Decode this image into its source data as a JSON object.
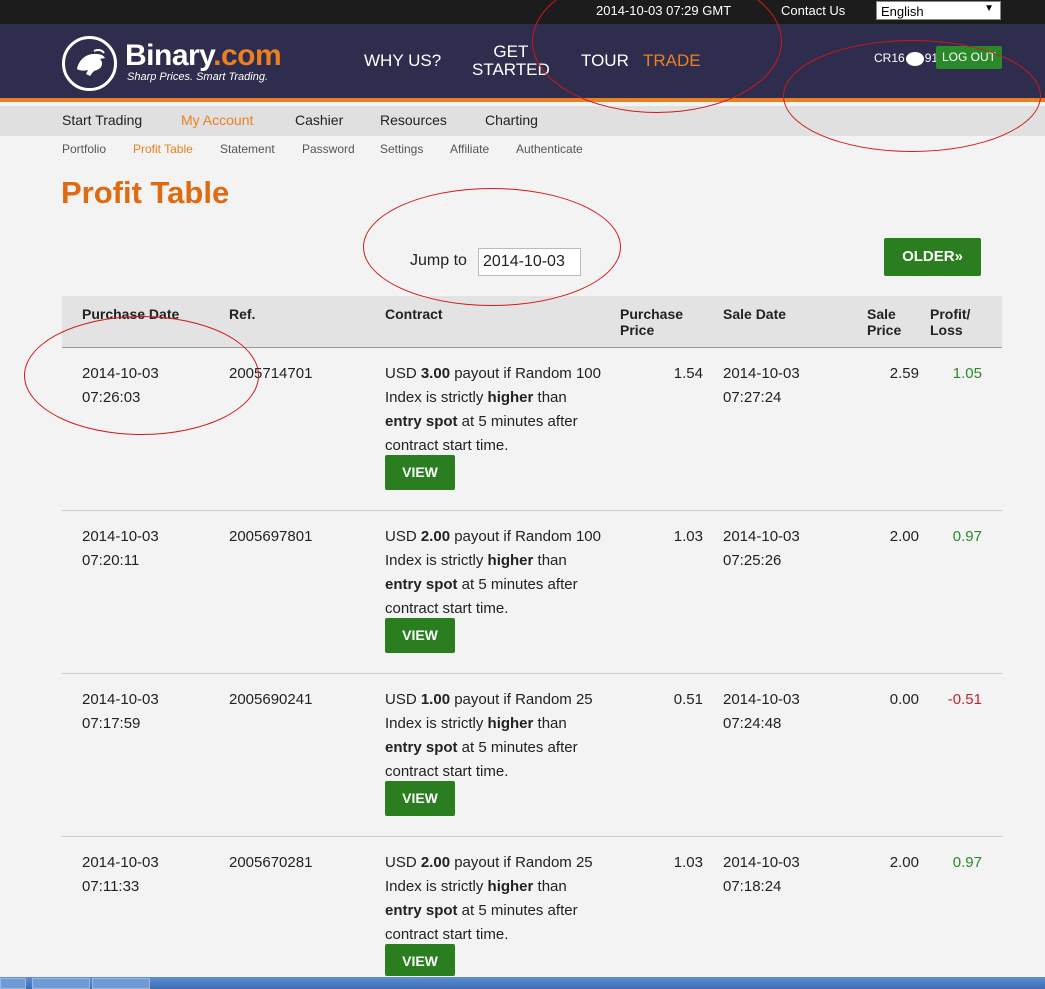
{
  "topbar": {
    "datetime": "2014-10-03 07:29 GMT",
    "contact": "Contact Us",
    "language": "English"
  },
  "header": {
    "brand_main": "Binary",
    "brand_suffix": ".com",
    "tagline": "Sharp Prices. Smart Trading.",
    "nav": {
      "why_us": "WHY US?",
      "get_started_1": "GET",
      "get_started_2": "STARTED",
      "tour": "TOUR",
      "trade": "TRADE"
    },
    "account_id": "CR16",
    "account_id_end": "91",
    "logout": "LOG OUT"
  },
  "menu": {
    "main": [
      "Start Trading",
      "My Account",
      "Cashier",
      "Resources",
      "Charting"
    ],
    "sub": [
      "Portfolio",
      "Profit Table",
      "Statement",
      "Password",
      "Settings",
      "Affiliate",
      "Authenticate"
    ]
  },
  "page": {
    "title": "Profit Table",
    "jump_label": "Jump to",
    "jump_value": "2014-10-03",
    "older": "OLDER»"
  },
  "table": {
    "headers": {
      "purchase_date": "Purchase Date",
      "ref": "Ref.",
      "contract": "Contract",
      "purchase_price_1": "Purchase",
      "purchase_price_2": "Price",
      "sale_date": "Sale Date",
      "sale_price_1": "Sale",
      "sale_price_2": "Price",
      "profit_1": "Profit/",
      "profit_2": "Loss"
    },
    "view_label": "VIEW",
    "rows": [
      {
        "pdate": "2014-10-03",
        "ptime": "07:26:03",
        "ref": "2005714701",
        "c1": "USD ",
        "c_amount": "3.00",
        "c2": " payout if Random 100 Index is strictly ",
        "c_dir": "higher",
        "c3": " than ",
        "c_spot": "entry spot",
        "c4": " at 5 minutes after contract start time.",
        "purchase": "1.54",
        "sdate": "2014-10-03",
        "stime": "07:27:24",
        "sale": "2.59",
        "profit": "1.05"
      },
      {
        "pdate": "2014-10-03",
        "ptime": "07:20:11",
        "ref": "2005697801",
        "c1": "USD ",
        "c_amount": "2.00",
        "c2": " payout if Random 100 Index is strictly ",
        "c_dir": "higher",
        "c3": " than ",
        "c_spot": "entry spot",
        "c4": " at 5 minutes after contract start time.",
        "purchase": "1.03",
        "sdate": "2014-10-03",
        "stime": "07:25:26",
        "sale": "2.00",
        "profit": "0.97"
      },
      {
        "pdate": "2014-10-03",
        "ptime": "07:17:59",
        "ref": "2005690241",
        "c1": "USD ",
        "c_amount": "1.00",
        "c2": " payout if Random 25 Index is strictly ",
        "c_dir": "higher",
        "c3": " than ",
        "c_spot": "entry spot",
        "c4": " at 5 minutes after contract start time.",
        "purchase": "0.51",
        "sdate": "2014-10-03",
        "stime": "07:24:48",
        "sale": "0.00",
        "profit": "-0.51"
      },
      {
        "pdate": "2014-10-03",
        "ptime": "07:11:33",
        "ref": "2005670281",
        "c1": "USD ",
        "c_amount": "2.00",
        "c2": " payout if Random 25 Index is strictly ",
        "c_dir": "higher",
        "c3": " than ",
        "c_spot": "entry spot",
        "c4": " at 5 minutes after contract start time.",
        "purchase": "1.03",
        "sdate": "2014-10-03",
        "stime": "07:18:24",
        "sale": "2.00",
        "profit": "0.97"
      }
    ]
  },
  "colors": {
    "brand_orange": "#e98024",
    "header_navy": "#2e2d4d",
    "button_green": "#2a7e1f",
    "profit_green": "#2a8a2a",
    "loss_red": "#c0272d",
    "annotation_red": "#d01a1a"
  }
}
